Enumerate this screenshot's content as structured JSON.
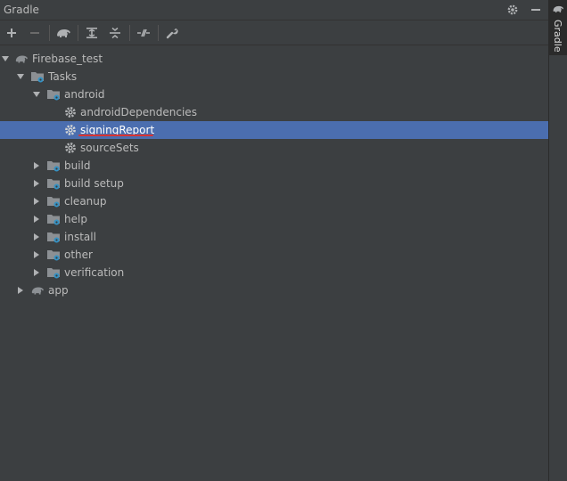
{
  "panel": {
    "title": "Gradle",
    "header_icons": [
      "gear-icon",
      "minimize-icon"
    ]
  },
  "toolbar": {
    "buttons": [
      "add-icon",
      "remove-icon",
      "gradle-elephant-icon",
      "expand-all-icon",
      "collapse-all-icon",
      "toggle-offline-icon",
      "settings-wrench-icon"
    ]
  },
  "tree": {
    "root": {
      "label": "Firebase_test",
      "expanded": true
    },
    "tasks": {
      "label": "Tasks",
      "expanded": true
    },
    "android": {
      "label": "android",
      "expanded": true
    },
    "android_children": [
      {
        "label": "androidDependencies"
      },
      {
        "label": "signingReport",
        "selected": true,
        "underlined": true
      },
      {
        "label": "sourceSets"
      }
    ],
    "task_groups": [
      {
        "label": "build"
      },
      {
        "label": "build setup"
      },
      {
        "label": "cleanup"
      },
      {
        "label": "help"
      },
      {
        "label": "install"
      },
      {
        "label": "other"
      },
      {
        "label": "verification"
      }
    ],
    "app": {
      "label": "app",
      "expanded": false
    }
  },
  "side_tab": {
    "label": "Gradle"
  },
  "colors": {
    "background": "#3c3f41",
    "selection": "#4b6eaf",
    "text": "#bbbbbb",
    "underline": "#d83333",
    "folder_blue": "#3592c4",
    "icon_gray": "#afb1b3"
  }
}
